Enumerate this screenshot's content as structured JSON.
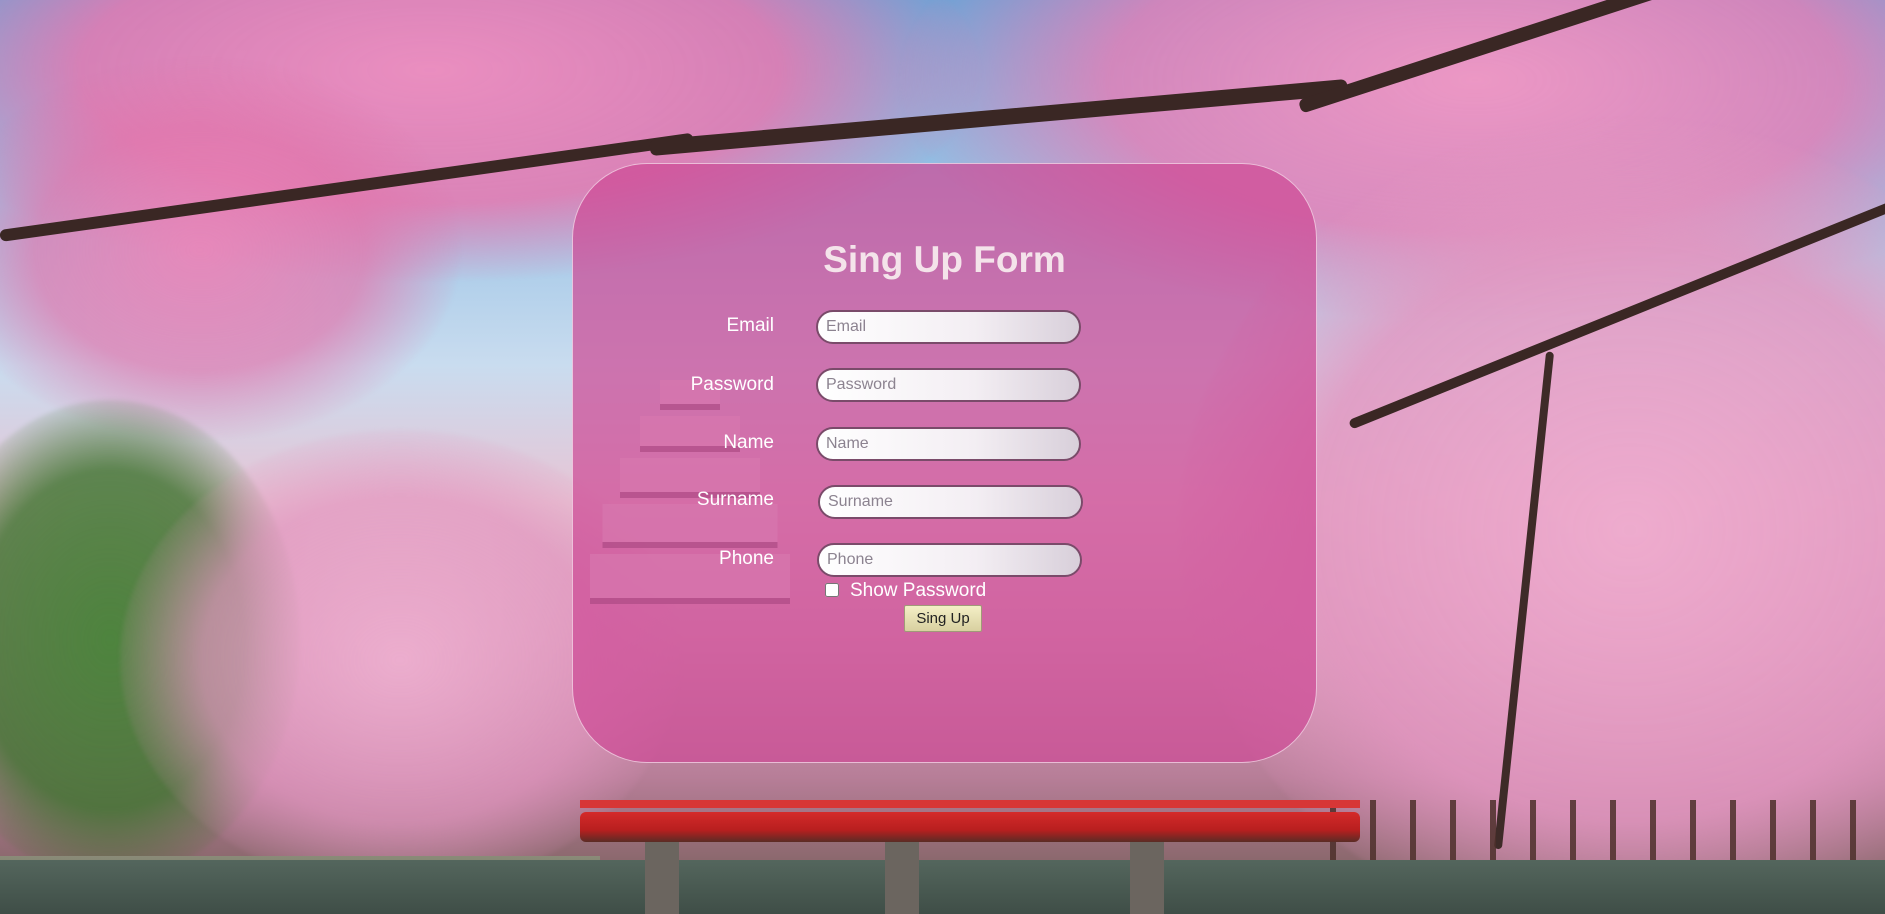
{
  "form": {
    "title": "Sing Up Form",
    "fields": [
      {
        "label": "Email",
        "placeholder": "Email"
      },
      {
        "label": "Password",
        "placeholder": "Password"
      },
      {
        "label": "Name",
        "placeholder": "Name"
      },
      {
        "label": "Surname",
        "placeholder": "Surname"
      },
      {
        "label": "Phone",
        "placeholder": "Phone"
      }
    ],
    "show_password_label": "Show Password",
    "submit_label": "Sing Up"
  },
  "colors": {
    "card_overlay": "#cd4b96",
    "title_text": "#f4e3ea",
    "label_text": "#ffffff",
    "bridge": "#d42a2a"
  }
}
